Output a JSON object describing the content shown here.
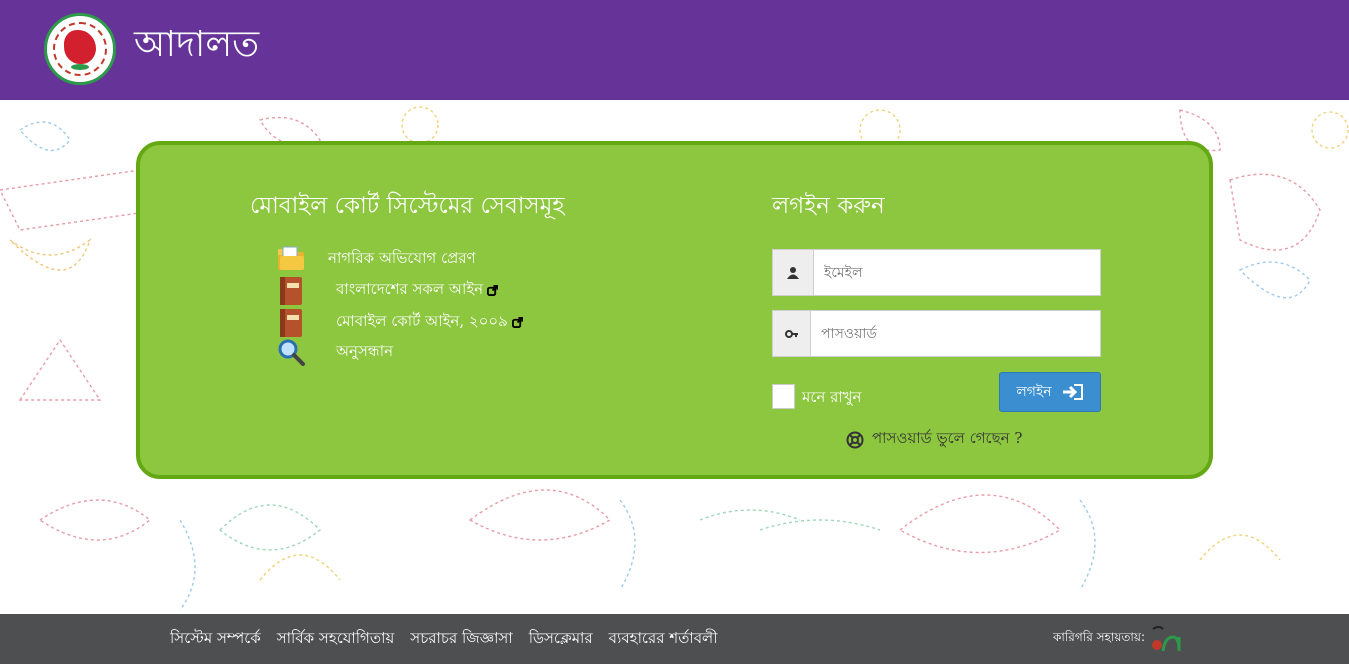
{
  "header": {
    "title": "আদালত",
    "logo": "bangladesh-government-seal"
  },
  "services": {
    "title": "মোবাইল কোর্ট সিস্টেমের সেবাসমূহ",
    "items": [
      {
        "label": "নাগরিক অভিযোগ প্রেরণ",
        "icon": "folder-icon",
        "external": false
      },
      {
        "label": "বাংলাদেশের সকল আইন",
        "icon": "law-book-icon",
        "external": true
      },
      {
        "label": "মোবাইল কোর্ট আইন, ২০০৯",
        "icon": "law-book-icon",
        "external": true
      },
      {
        "label": "অনুসন্ধান",
        "icon": "magnifier-icon",
        "external": false
      }
    ]
  },
  "login": {
    "title": "লগইন করুন",
    "email_placeholder": "ইমেইল",
    "password_placeholder": "পাসওয়ার্ড",
    "remember_label": "মনে রাখুন",
    "remember_checked": false,
    "button_label": "লগইন",
    "forgot_label": "পাসওয়ার্ড ভুলে গেছেন ?"
  },
  "footer": {
    "links": [
      "সিস্টেম সম্পর্কে",
      "সার্বিক সহযোগিতায়",
      "সচরাচর জিজ্ঞাসা",
      "ডিসক্লেমার",
      "ব্যবহারের শর্তাবলী"
    ],
    "credit_label": "কারিগরি সহায়তায়:",
    "credit_logo": "a2i"
  },
  "colors": {
    "header": "#663399",
    "panel": "#8dc63f",
    "panel_border": "#64a813",
    "button": "#3b8fd0",
    "footer": "#4d4f50"
  }
}
